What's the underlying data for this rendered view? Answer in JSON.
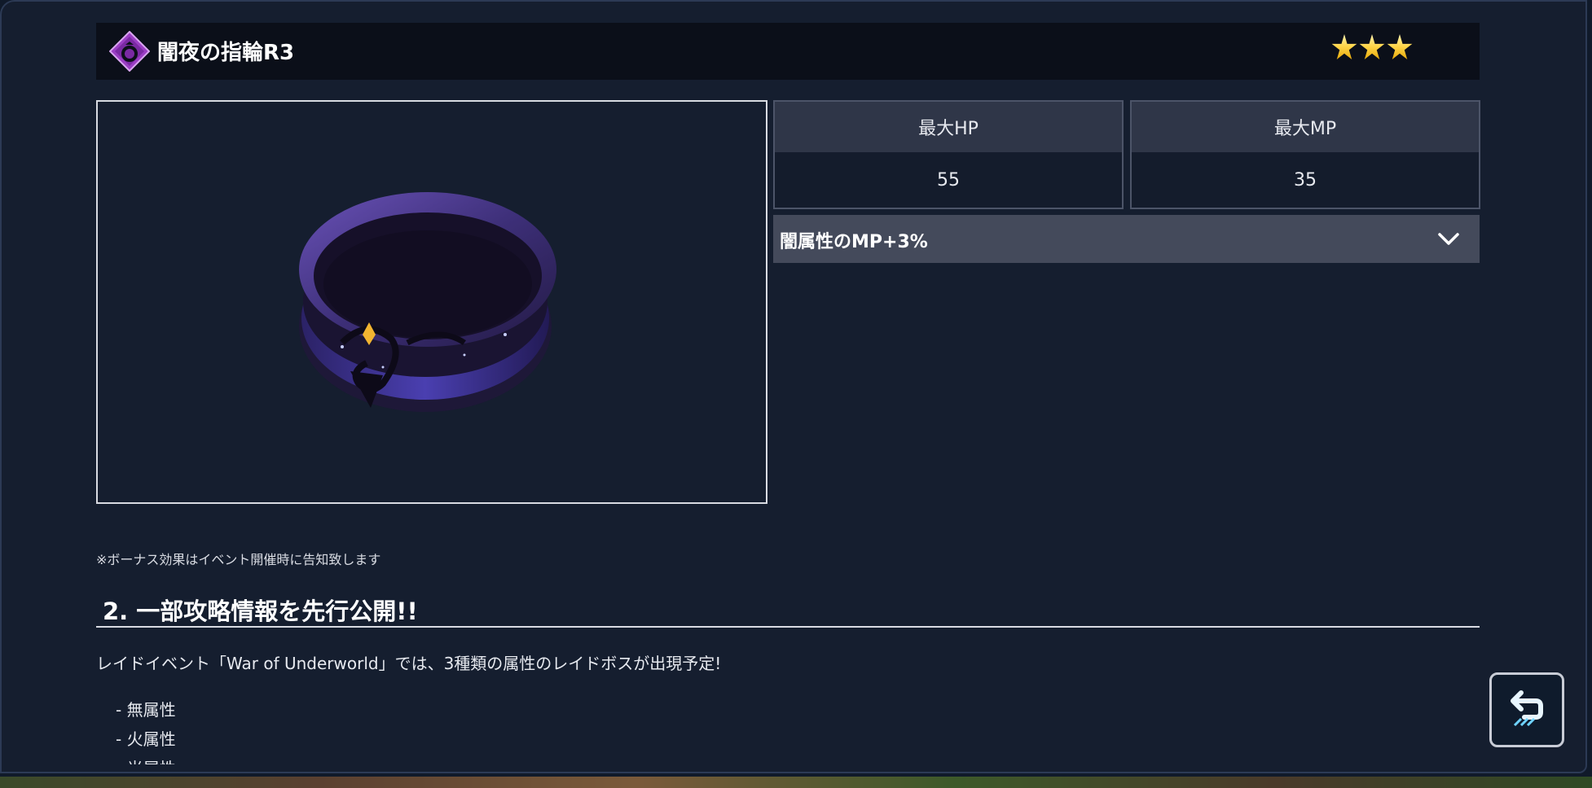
{
  "item": {
    "title": "闇夜の指輪R3",
    "type_icon": "ring-icon",
    "rarity_stars": 3,
    "image": "ring-image"
  },
  "stats": [
    {
      "label": "最大HP",
      "value": "55"
    },
    {
      "label": "最大MP",
      "value": "35"
    }
  ],
  "bonus": {
    "label": "闇属性のMP+3%",
    "icon": "chevron-down-icon"
  },
  "note": "※ボーナス効果はイベント開催時に告知致します",
  "section": {
    "heading": "2. 一部攻略情報を先行公開!!",
    "body": "レイドイベント「War of Underworld」では、3種類の属性のレイドボスが出現予定!",
    "attributes": [
      "- 無属性",
      "- 火属性",
      "- 光属性"
    ]
  },
  "controls": {
    "back_icon": "back-arrow-icon"
  },
  "colors": {
    "panel_bg": "#151e2f",
    "title_bar_bg": "#0b0f19",
    "badge_purple": "#9b3ec4",
    "star_gold": "#ffd447",
    "stat_header_bg": "#2f3648",
    "bonus_bg": "#444a5b"
  }
}
